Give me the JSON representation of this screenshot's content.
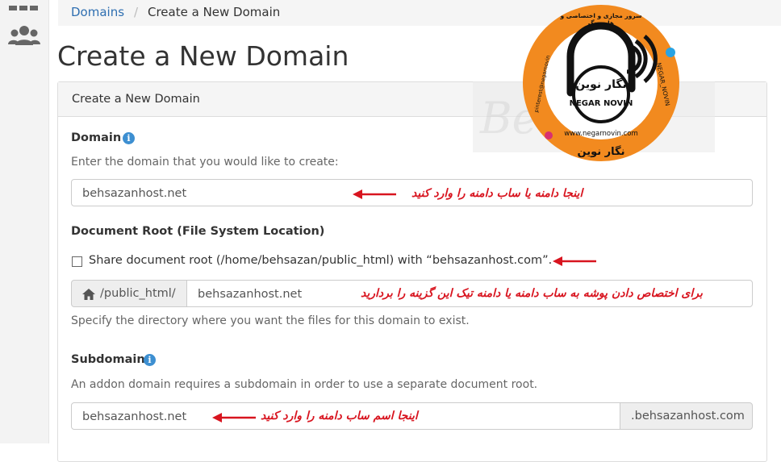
{
  "breadcrumb": {
    "parent": "Domains",
    "separator": "/",
    "current": "Create a New Domain"
  },
  "page_title": "Create a New Domain",
  "panel_title": "Create a New Domain",
  "domain": {
    "label": "Domain",
    "help": "Enter the domain that you would like to create:",
    "value": "behsazanhost.net",
    "note": "اینجا دامنه یا ساب دامنه را وارد کنید"
  },
  "docroot": {
    "label": "Document Root (File System Location)",
    "share_label": "Share document root (/home/behsazan/public_html) with “behsazanhost.com”.",
    "prefix": "/public_html/",
    "value": "behsazanhost.net",
    "note": "برای اختصاص دادن پوشه به ساب دامنه یا دامنه تیک این گزینه را بردارید",
    "help": "Specify the directory where you want the files for this domain to exist."
  },
  "subdomain": {
    "label": "Subdomain",
    "help": "An addon domain requires a subdomain in order to use a separate document root.",
    "value": "behsazanhost.net",
    "suffix": ".behsazanhost.com",
    "note": "اینجا اسم ساب دامنه را وارد کنید"
  },
  "logo": {
    "name_fa": "نگار نوین",
    "name_en": "NEGAR NOVIN",
    "url": "www.negarnovin.com",
    "ring_top": "سرور مجازی و اختصاصی و هاستینگ",
    "ring_left": "pinterest@negarnovin",
    "ring_right": "NEGAR_NOVIN",
    "bottom": "نگار نوین"
  },
  "watermark": {
    "text": "Beh"
  },
  "colors": {
    "accent": "#2f6fb1",
    "note": "#d8141f",
    "logo_orange": "#f28a1f"
  },
  "icons": {
    "apps": "apps-grid-icon",
    "users": "users-icon",
    "home": "home-icon",
    "info": "info-icon",
    "arrow": "red-arrow-icon"
  }
}
